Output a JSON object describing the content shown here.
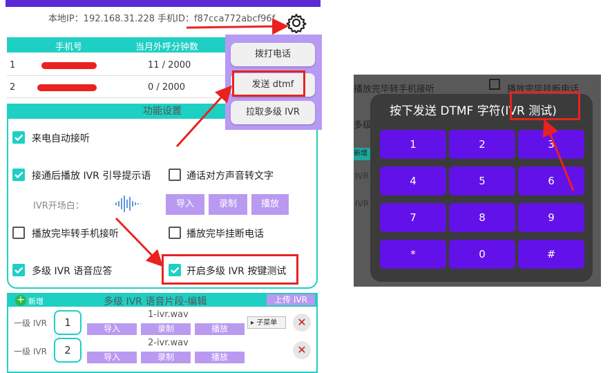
{
  "header": {
    "ip_line": "本地IP：192.168.31.228 手机ID：f87cca772abcf96f"
  },
  "phone_table": {
    "col_phone": "手机号",
    "col_minutes": "当月外呼分钟数",
    "rows": [
      {
        "index": "1",
        "phone": "1**********",
        "minutes": "11 / 2000"
      },
      {
        "index": "2",
        "phone": "1**********",
        "minutes": "0 / 2000"
      }
    ]
  },
  "popup_menu": {
    "items": [
      "拨打电话",
      "发送 dtmf",
      "拉取多级 IVR"
    ]
  },
  "functions": {
    "title": "功能设置",
    "auto_answer": "来电自动接听",
    "play_ivr_guide": "接通后播放 IVR 引导提示语",
    "speech_to_text": "通话对方声音转文字",
    "ivr_opening": "IVR开场白：",
    "import": "导入",
    "record": "录制",
    "play": "播放",
    "play_done_transfer": "播放完毕转手机接听",
    "play_done_hangup": "播放完毕挂断电话",
    "multi_ivr": "多级 IVR 语音应答",
    "multi_ivr_key_test": "开启多级 IVR 按键测试"
  },
  "ivr_edit": {
    "add": "新增",
    "title": "多级 IVR 语音片段-编辑",
    "upload": "上传 IVR",
    "submenu": "子菜单",
    "rows": [
      {
        "level": "一级 IVR",
        "num": "1",
        "file": "1-ivr.wav"
      },
      {
        "level": "一级 IVR",
        "num": "2",
        "file": "2-ivr.wav"
      }
    ],
    "import": "导入",
    "record": "录制",
    "play": "播放"
  },
  "right_screenshot": {
    "bg_text_1": "播放完毕转手机接听",
    "bg_text_2": "播放完毕挂断电话",
    "bg_text_3": "多级",
    "bg_text_4": "新增",
    "bg_text_5": "IVR",
    "bg_text_6": "IVR",
    "dialog_title": "按下发送 DTMF 字符(IVR 测试)",
    "keys": [
      "1",
      "2",
      "3",
      "4",
      "5",
      "6",
      "7",
      "8",
      "9",
      "*",
      "0",
      "#"
    ]
  },
  "colors": {
    "teal": "#1ecfc3",
    "purple": "#b99af0",
    "key_purple": "#6211e8",
    "red": "#e8231f"
  }
}
